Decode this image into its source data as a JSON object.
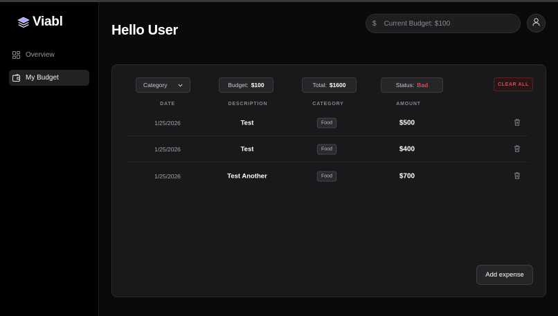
{
  "app": {
    "name": "Viabl",
    "logo_icon": "layers-icon"
  },
  "sidebar": {
    "items": [
      {
        "label": "Overview",
        "icon": "grid-icon",
        "active": false
      },
      {
        "label": "My Budget",
        "icon": "wallet-icon",
        "active": true
      }
    ]
  },
  "header": {
    "title": "Hello User",
    "budget_pill": {
      "currency_symbol": "$",
      "placeholder": "Current Budget: $100"
    },
    "avatar_icon": "user-icon"
  },
  "filters": {
    "category_select": "Category",
    "budget": {
      "label": "Budget:",
      "value": "$100"
    },
    "total": {
      "label": "Total:",
      "value": "$1600"
    },
    "status": {
      "label": "Status:",
      "value": "Bad"
    },
    "clear_all_label": "CLEAR ALL"
  },
  "table": {
    "columns": [
      "DATE",
      "DESCRIPTION",
      "CATEGORY",
      "AMOUNT"
    ],
    "rows": [
      {
        "date": "1/25/2026",
        "description": "Test",
        "category": "Food",
        "amount": "$500"
      },
      {
        "date": "1/25/2026",
        "description": "Test",
        "category": "Food",
        "amount": "$400"
      },
      {
        "date": "1/25/2026",
        "description": "Test Another",
        "category": "Food",
        "amount": "$700"
      }
    ]
  },
  "add_expense_label": "Add expense",
  "colors": {
    "background": "#0a0a0b",
    "card": "#19191b",
    "danger": "#e5484d",
    "text": "#ffffff"
  }
}
